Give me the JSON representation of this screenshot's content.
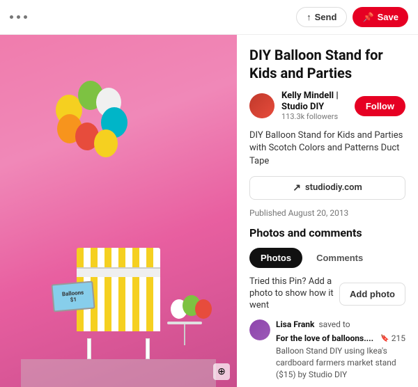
{
  "topbar": {
    "send_label": "Send",
    "save_label": "Save"
  },
  "pin": {
    "title": "DIY Balloon Stand for Kids and Parties",
    "description": "DIY Balloon Stand for Kids and Parties with Scotch Colors and Patterns Duct Tape",
    "source_url": "studiodiy.com",
    "published": "Published August 20, 2013"
  },
  "author": {
    "name": "Kelly Mindell | Studio DIY",
    "followers": "113.3k followers",
    "follow_label": "Follow"
  },
  "sections": {
    "photos_comments_title": "Photos and comments",
    "photos_tab": "Photos",
    "comments_tab": "Comments",
    "tried_text": "Tried this Pin? Add a photo to show how it went",
    "add_photo_label": "Add photo"
  },
  "comment": {
    "user": "Lisa Frank",
    "action": "saved to",
    "board": "For the love of balloons....",
    "save_count": "215",
    "text": "Balloon Stand DIY using Ikea's cardboard farmers market stand ($15) by Studio DIY"
  },
  "icons": {
    "dots": "•••",
    "send_arrow": "↑",
    "save_pin": "📌",
    "link_arrow": "↗",
    "fullscreen": "⊕",
    "save_bookmark": "🔖"
  },
  "colors": {
    "red": "#E60023",
    "dark": "#111111",
    "gray": "#767676",
    "border": "#dddddd"
  }
}
